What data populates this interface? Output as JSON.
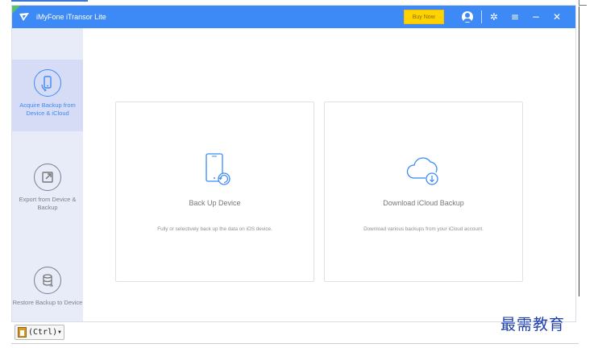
{
  "app": {
    "title": "iMyFone iTransor Lite",
    "accent_color": "#3d8af7"
  },
  "titlebar": {
    "buy_label": "Buy Now",
    "icons": [
      "user-icon",
      "gear-icon",
      "menu-icon",
      "minimize-icon",
      "close-icon"
    ],
    "menu_glyph": "≡",
    "minimize_glyph": "−",
    "close_glyph": "✕",
    "gear_glyph": "✲"
  },
  "sidebar": {
    "items": [
      {
        "label": "Acquire Backup from Device & iCloud",
        "icon": "phone-sync-icon",
        "active": true
      },
      {
        "label": "Export from Device & Backup",
        "icon": "export-icon",
        "active": false
      },
      {
        "label": "Restore Backup to Device",
        "icon": "database-restore-icon",
        "active": false
      }
    ]
  },
  "cards": [
    {
      "title": "Back Up Device",
      "desc": "Fully or selectively back up the data on iOS device.",
      "icon": "tablet-backup-icon"
    },
    {
      "title": "Download iCloud Backup",
      "desc": "Download various backups from your iCloud account.",
      "icon": "cloud-download-icon"
    }
  ],
  "paste_tag": {
    "label": "(Ctrl)"
  },
  "watermark": {
    "text": "最需教育"
  }
}
